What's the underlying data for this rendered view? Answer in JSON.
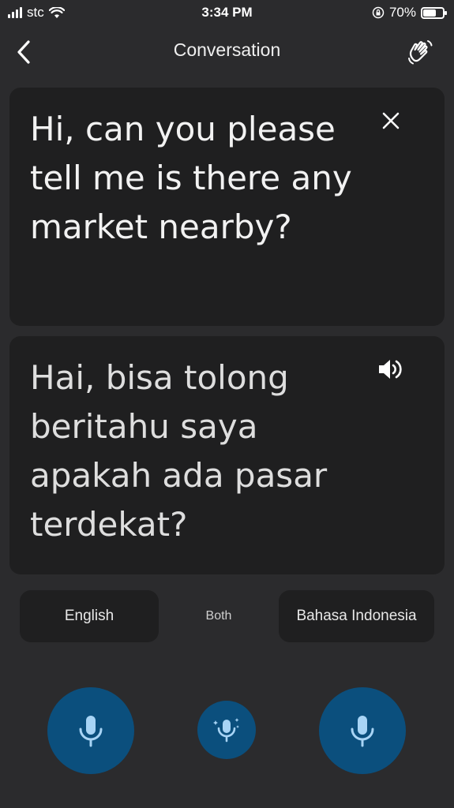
{
  "status_bar": {
    "carrier": "stc",
    "time": "3:34 PM",
    "battery_percent": "70%",
    "battery_level": 0.7
  },
  "nav": {
    "title": "Conversation",
    "back_icon": "chevron-left-icon",
    "action_icon": "waving-hand-icon"
  },
  "source_card": {
    "text": "Hi, can you please tell me is there any market nearby?",
    "icon": "close-icon"
  },
  "target_card": {
    "text": "Hai, bisa tolong beritahu saya apakah ada pasar terdekat?",
    "icon": "speaker-icon"
  },
  "languages": {
    "left": "English",
    "both": "Both",
    "right": "Bahasa Indonesia"
  },
  "colors": {
    "background": "#2b2b2d",
    "card": "#1f1f20",
    "mic_button": "#0b4f7d",
    "mic_icon": "#a8d4f5"
  }
}
